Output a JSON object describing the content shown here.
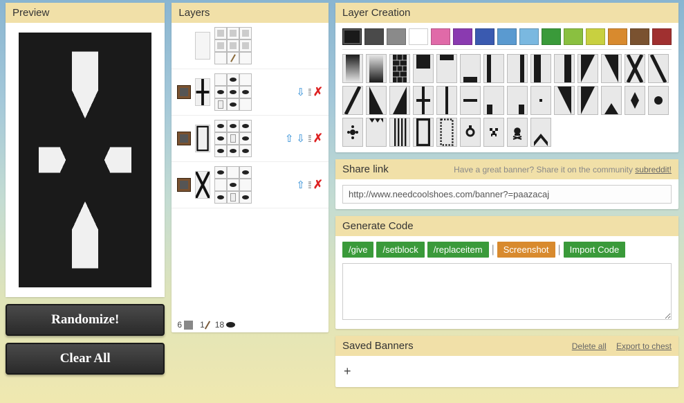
{
  "preview": {
    "title": "Preview",
    "randomize": "Randomize!",
    "clearAll": "Clear All"
  },
  "layers": {
    "title": "Layers",
    "footer": {
      "wool": "6",
      "stick": "1",
      "dye": "18"
    },
    "items": [
      {
        "pattern": "base",
        "craft": "wool"
      },
      {
        "pattern": "straight_cross",
        "craft": "dye_cross"
      },
      {
        "pattern": "border",
        "craft": "dye_border"
      },
      {
        "pattern": "cross",
        "craft": "dye_x"
      }
    ]
  },
  "creation": {
    "title": "Layer Creation",
    "colors": [
      "#1a1a1a",
      "#4a4a4a",
      "#8a8a8a",
      "#ffffff",
      "#e06aa8",
      "#8a3ab0",
      "#3a5ab0",
      "#5a9ad0",
      "#7ab8e0",
      "#3a9a3a",
      "#8ac040",
      "#c8d040",
      "#d88a2e",
      "#7a5230",
      "#a03030"
    ],
    "patterns": [
      "gradient",
      "gradient_up",
      "bricks",
      "half_h",
      "stripe_top",
      "stripe_bottom",
      "stripe_left",
      "stripe_right",
      "half_v",
      "half_v_r",
      "diag_l",
      "diag_r",
      "cross",
      "diag_lr",
      "diag_rl",
      "half_diag_l",
      "half_diag_r",
      "straight_cross",
      "stripe_center",
      "stripe_middle",
      "square_bl",
      "square_br",
      "dot",
      "diag_ul",
      "diag_ur",
      "triangle_b",
      "rhombus",
      "circle",
      "flower",
      "triangles_t",
      "small_stripes",
      "border",
      "curly_border",
      "mojang",
      "creeper",
      "skull",
      "chevron"
    ]
  },
  "share": {
    "title": "Share link",
    "hint": "Have a great banner? Share it on the community ",
    "hintLink": "subreddit!",
    "url": "http://www.needcoolshoes.com/banner?=paazacaj"
  },
  "generate": {
    "title": "Generate Code",
    "buttons": {
      "give": "/give",
      "setblock": "/setblock",
      "replaceitem": "/replaceitem",
      "screenshot": "Screenshot",
      "import": "Import Code"
    },
    "code": ""
  },
  "saved": {
    "title": "Saved Banners",
    "deleteAll": "Delete all",
    "export": "Export to chest",
    "add": "+"
  }
}
